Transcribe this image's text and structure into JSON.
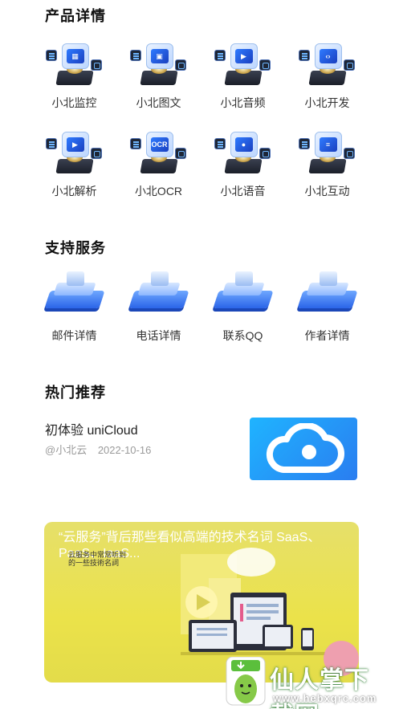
{
  "products": {
    "title": "产品详情",
    "items": [
      {
        "label": "小北监控",
        "glyph": "▦"
      },
      {
        "label": "小北图文",
        "glyph": "▣"
      },
      {
        "label": "小北音频",
        "glyph": "▶"
      },
      {
        "label": "小北开发",
        "glyph": "‹›"
      },
      {
        "label": "小北解析",
        "glyph": "▶"
      },
      {
        "label": "小北OCR",
        "glyph": "OCR"
      },
      {
        "label": "小北语音",
        "glyph": "●"
      },
      {
        "label": "小北互动",
        "glyph": "≡"
      }
    ]
  },
  "services": {
    "title": "支持服务",
    "items": [
      {
        "label": "邮件详情"
      },
      {
        "label": "电话详情"
      },
      {
        "label": "联系QQ"
      },
      {
        "label": "作者详情"
      }
    ]
  },
  "recommend": {
    "title": "热门推荐",
    "article": {
      "title": "初体验 uniCloud",
      "author": "@小北云",
      "date": "2022-10-16"
    }
  },
  "banner": {
    "title": "“云服务”背后那些看似高端的技术名词 SaaS、PaaS、IaaS...",
    "subtitle_line1": "云服务中常常听到",
    "subtitle_line2": "的一些技術名詞"
  },
  "watermark": {
    "text": "仙人掌下载网",
    "url": "www.hebxqrc.com"
  },
  "colors": {
    "accent_blue": "#2a7df0",
    "banner_yellow": "#ebe24a"
  }
}
